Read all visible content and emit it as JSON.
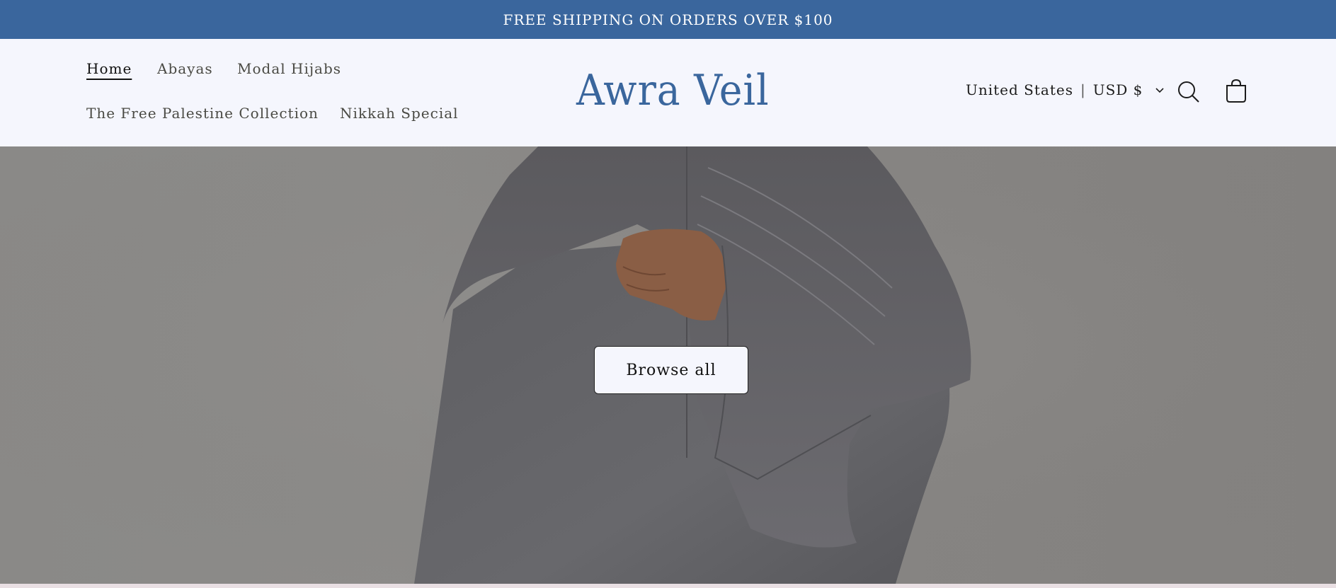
{
  "announcement": {
    "text": "FREE SHIPPING ON ORDERS OVER $100"
  },
  "header": {
    "logo": "Awra Veil",
    "nav": [
      {
        "label": "Home",
        "active": true
      },
      {
        "label": "Abayas"
      },
      {
        "label": "Modal Hijabs"
      },
      {
        "label": "The Free Palestine Collection"
      },
      {
        "label": "Nikkah Special"
      }
    ],
    "locale": {
      "country": "United States",
      "separator": "|",
      "currency": "USD $"
    },
    "icons": {
      "search": "search-icon",
      "cart": "cart-icon",
      "dropdown": "chevron-down-icon"
    }
  },
  "hero": {
    "cta_label": "Browse all"
  },
  "colors": {
    "brand": "#3a669d",
    "header_bg": "#f5f6fd"
  }
}
